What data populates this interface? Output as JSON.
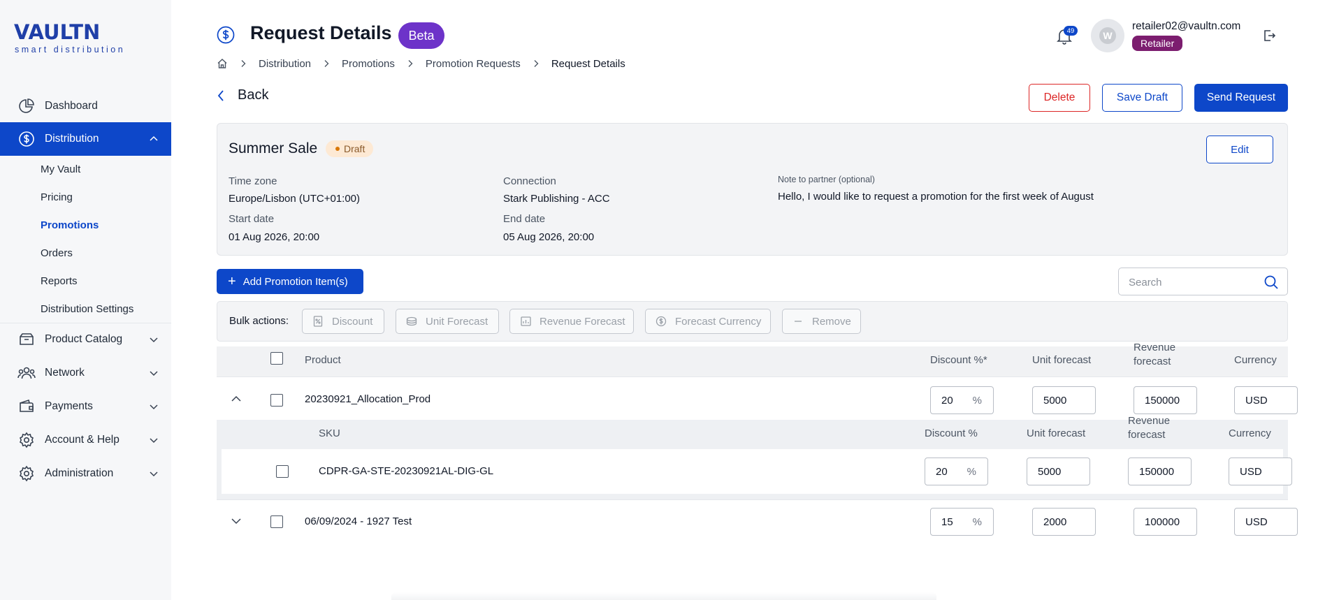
{
  "brand": {
    "word": "VAULTN",
    "tagline": "smart distribution"
  },
  "sidebar": {
    "items": [
      {
        "label": "Dashboard",
        "icon": "dashboard-icon"
      },
      {
        "label": "Distribution",
        "icon": "dollar-circle-icon",
        "active": true,
        "expanded": true
      },
      {
        "label": "Product Catalog",
        "icon": "catalog-icon"
      },
      {
        "label": "Network",
        "icon": "network-icon"
      },
      {
        "label": "Payments",
        "icon": "wallet-icon"
      },
      {
        "label": "Account & Help",
        "icon": "gear-icon"
      },
      {
        "label": "Administration",
        "icon": "gear-icon"
      }
    ],
    "sub_items": [
      "My Vault",
      "Pricing",
      "Promotions",
      "Orders",
      "Reports",
      "Distribution Settings"
    ],
    "active_sub": "Promotions"
  },
  "header": {
    "title": "Request Details",
    "badge": "Beta",
    "notifications": "49",
    "avatar_letter": "W",
    "email": "retailer02@vaultn.com",
    "role": "Retailer"
  },
  "breadcrumb": [
    "Distribution",
    "Promotions",
    "Promotion Requests",
    "Request Details"
  ],
  "actions": {
    "back": "Back",
    "delete": "Delete",
    "save_draft": "Save Draft",
    "send": "Send Request"
  },
  "promotion": {
    "name": "Summer Sale",
    "status": "Draft",
    "edit": "Edit",
    "timezone_label": "Time zone",
    "timezone": "Europe/Lisbon (UTC+01:00)",
    "connection_label": "Connection",
    "connection": "Stark Publishing - ACC",
    "note_label": "Note to partner (optional)",
    "note": "Hello, I would like to request a promotion for the first week of August",
    "start_label": "Start date",
    "start": "01 Aug 2026, 20:00",
    "end_label": "End date",
    "end": "05 Aug 2026, 20:00"
  },
  "toolbar": {
    "add": "Add Promotion Item(s)",
    "search_placeholder": "Search"
  },
  "bulk": {
    "label": "Bulk actions:",
    "buttons": [
      "Discount",
      "Unit Forecast",
      "Revenue Forecast",
      "Forecast Currency",
      "Remove"
    ]
  },
  "table": {
    "headers": {
      "product": "Product",
      "discount": "Discount %*",
      "unit": "Unit forecast",
      "revenue": "Revenue forecast",
      "currency": "Currency"
    },
    "sub_headers": {
      "sku": "SKU",
      "discount": "Discount %",
      "unit": "Unit forecast",
      "revenue": "Revenue forecast",
      "currency": "Currency"
    },
    "pct": "%",
    "rows": [
      {
        "product": "20230921_Allocation_Prod",
        "discount": "20",
        "unit": "5000",
        "revenue": "150000",
        "currency": "USD",
        "expanded": true,
        "skus": [
          {
            "sku": "CDPR-GA-STE-20230921AL-DIG-GL",
            "discount": "20",
            "unit": "5000",
            "revenue": "150000",
            "currency": "USD"
          }
        ]
      },
      {
        "product": "06/09/2024 - 1927 Test",
        "discount": "15",
        "unit": "2000",
        "revenue": "100000",
        "currency": "USD",
        "expanded": false
      }
    ]
  },
  "colors": {
    "primary": "#0d47c9",
    "beta": "#6d33c9",
    "role": "#7c1d6f",
    "danger": "#dc2626",
    "draft_bg": "#fde9d4"
  }
}
